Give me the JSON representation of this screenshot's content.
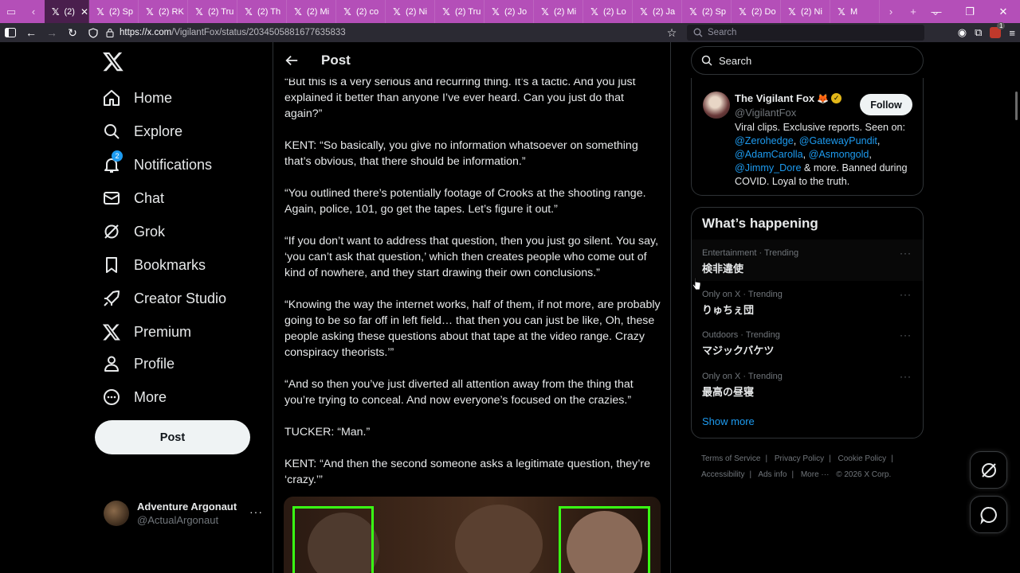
{
  "browser": {
    "tabs": [
      {
        "label": "(2)",
        "active": true
      },
      {
        "label": "(2) Sp",
        "active": false
      },
      {
        "label": "(2) RK",
        "active": false
      },
      {
        "label": "(2) Tru",
        "active": false
      },
      {
        "label": "(2) Th",
        "active": false
      },
      {
        "label": "(2) Mi",
        "active": false
      },
      {
        "label": "(2) co",
        "active": false
      },
      {
        "label": "(2) Ni",
        "active": false
      },
      {
        "label": "(2) Tru",
        "active": false
      },
      {
        "label": "(2) Jo",
        "active": false
      },
      {
        "label": "(2) Mi",
        "active": false
      },
      {
        "label": "(2) Lo",
        "active": false
      },
      {
        "label": "(2) Ja",
        "active": false
      },
      {
        "label": "(2) Sp",
        "active": false
      },
      {
        "label": "(2) Do",
        "active": false
      },
      {
        "label": "(2) Ni",
        "active": false
      },
      {
        "label": "M",
        "active": false
      }
    ],
    "url_host": "https://x.com",
    "url_path": "/VigilantFox/status/2034505881677635833",
    "search_placeholder": "Search",
    "extension_badge": "1"
  },
  "nav": {
    "items": [
      {
        "label": "Home",
        "icon": "home-icon"
      },
      {
        "label": "Explore",
        "icon": "search-icon"
      },
      {
        "label": "Notifications",
        "icon": "bell-icon",
        "badge": "2"
      },
      {
        "label": "Chat",
        "icon": "mail-icon"
      },
      {
        "label": "Grok",
        "icon": "grok-icon"
      },
      {
        "label": "Bookmarks",
        "icon": "bookmark-icon"
      },
      {
        "label": "Creator Studio",
        "icon": "rocket-icon"
      },
      {
        "label": "Premium",
        "icon": "x-icon"
      },
      {
        "label": "Profile",
        "icon": "person-icon"
      },
      {
        "label": "More",
        "icon": "more-circle-icon"
      }
    ],
    "post_button": "Post",
    "account": {
      "name": "Adventure Argonaut",
      "handle": "@ActualArgonaut"
    }
  },
  "main": {
    "header_title": "Post",
    "paragraphs": [
      "“But this is a very serious and recurring thing. It’s a tactic. And you just explained it better than anyone I’ve ever heard. Can you just do that again?”",
      "KENT: “So basically, you give no information whatsoever on something that’s obvious, that there should be information.”",
      "“You outlined there’s potentially footage of Crooks at the shooting range. Again, police, 101, go get the tapes. Let’s figure it out.”",
      "“If you don’t want to address that question, then you just go silent. You say, ‘you can’t ask that question,’ which then creates people who come out of kind of nowhere, and they start drawing their own conclusions.”",
      "“Knowing the way the internet works, half of them, if not more, are probably going to be so far off in left field… that then you can just be like, Oh, these people asking these questions about that tape at the video range. Crazy conspiracy theorists.’”",
      "“And so then you’ve just diverted all attention away from the thing that you’re trying to conceal. And now everyone’s focused on the crazies.”",
      "TUCKER: “Man.”",
      "KENT: “And then the second someone asks a legitimate question, they’re ‘crazy.’”"
    ]
  },
  "right": {
    "search_placeholder": "Search",
    "profile": {
      "name": "The Vigilant Fox",
      "emoji": "🦊",
      "handle": "@VigilantFox",
      "follow_label": "Follow",
      "bio_1": "Viral clips. Exclusive reports. Seen on: ",
      "links": [
        "@Zerohedge",
        "@GatewayPundit",
        "@AdamCarolla",
        "@Asmongold",
        "@Jimmy_Dore"
      ],
      "bio_2": " & more. Banned during COVID. Loyal to the truth."
    },
    "trends_title": "What’s happening",
    "trends": [
      {
        "meta": "Entertainment · Trending",
        "name": "検非違使"
      },
      {
        "meta": "Only on X · Trending",
        "name": "りゅちぇ団"
      },
      {
        "meta": "Outdoors · Trending",
        "name": "マジックバケツ"
      },
      {
        "meta": "Only on X · Trending",
        "name": "最高の昼寝"
      }
    ],
    "show_more": "Show more",
    "footer": {
      "terms": "Terms of Service",
      "privacy": "Privacy Policy",
      "cookie": "Cookie Policy",
      "accessibility": "Accessibility",
      "ads": "Ads info",
      "more": "More ···",
      "copyright": "© 2026 X Corp."
    }
  },
  "colors": {
    "tabbar": "#b44fb8",
    "accent": "#1d9bf0",
    "background": "#000000",
    "highlight_box": "#39ff14"
  }
}
